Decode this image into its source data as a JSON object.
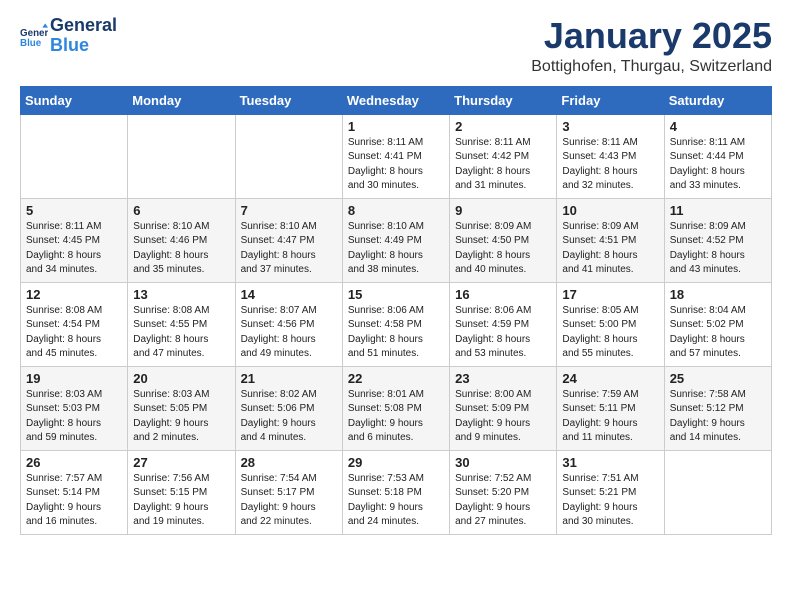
{
  "header": {
    "logo_general": "General",
    "logo_blue": "Blue",
    "month_title": "January 2025",
    "location": "Bottighofen, Thurgau, Switzerland"
  },
  "days_of_week": [
    "Sunday",
    "Monday",
    "Tuesday",
    "Wednesday",
    "Thursday",
    "Friday",
    "Saturday"
  ],
  "weeks": [
    [
      {
        "day": "",
        "info": ""
      },
      {
        "day": "",
        "info": ""
      },
      {
        "day": "",
        "info": ""
      },
      {
        "day": "1",
        "info": "Sunrise: 8:11 AM\nSunset: 4:41 PM\nDaylight: 8 hours\nand 30 minutes."
      },
      {
        "day": "2",
        "info": "Sunrise: 8:11 AM\nSunset: 4:42 PM\nDaylight: 8 hours\nand 31 minutes."
      },
      {
        "day": "3",
        "info": "Sunrise: 8:11 AM\nSunset: 4:43 PM\nDaylight: 8 hours\nand 32 minutes."
      },
      {
        "day": "4",
        "info": "Sunrise: 8:11 AM\nSunset: 4:44 PM\nDaylight: 8 hours\nand 33 minutes."
      }
    ],
    [
      {
        "day": "5",
        "info": "Sunrise: 8:11 AM\nSunset: 4:45 PM\nDaylight: 8 hours\nand 34 minutes."
      },
      {
        "day": "6",
        "info": "Sunrise: 8:10 AM\nSunset: 4:46 PM\nDaylight: 8 hours\nand 35 minutes."
      },
      {
        "day": "7",
        "info": "Sunrise: 8:10 AM\nSunset: 4:47 PM\nDaylight: 8 hours\nand 37 minutes."
      },
      {
        "day": "8",
        "info": "Sunrise: 8:10 AM\nSunset: 4:49 PM\nDaylight: 8 hours\nand 38 minutes."
      },
      {
        "day": "9",
        "info": "Sunrise: 8:09 AM\nSunset: 4:50 PM\nDaylight: 8 hours\nand 40 minutes."
      },
      {
        "day": "10",
        "info": "Sunrise: 8:09 AM\nSunset: 4:51 PM\nDaylight: 8 hours\nand 41 minutes."
      },
      {
        "day": "11",
        "info": "Sunrise: 8:09 AM\nSunset: 4:52 PM\nDaylight: 8 hours\nand 43 minutes."
      }
    ],
    [
      {
        "day": "12",
        "info": "Sunrise: 8:08 AM\nSunset: 4:54 PM\nDaylight: 8 hours\nand 45 minutes."
      },
      {
        "day": "13",
        "info": "Sunrise: 8:08 AM\nSunset: 4:55 PM\nDaylight: 8 hours\nand 47 minutes."
      },
      {
        "day": "14",
        "info": "Sunrise: 8:07 AM\nSunset: 4:56 PM\nDaylight: 8 hours\nand 49 minutes."
      },
      {
        "day": "15",
        "info": "Sunrise: 8:06 AM\nSunset: 4:58 PM\nDaylight: 8 hours\nand 51 minutes."
      },
      {
        "day": "16",
        "info": "Sunrise: 8:06 AM\nSunset: 4:59 PM\nDaylight: 8 hours\nand 53 minutes."
      },
      {
        "day": "17",
        "info": "Sunrise: 8:05 AM\nSunset: 5:00 PM\nDaylight: 8 hours\nand 55 minutes."
      },
      {
        "day": "18",
        "info": "Sunrise: 8:04 AM\nSunset: 5:02 PM\nDaylight: 8 hours\nand 57 minutes."
      }
    ],
    [
      {
        "day": "19",
        "info": "Sunrise: 8:03 AM\nSunset: 5:03 PM\nDaylight: 8 hours\nand 59 minutes."
      },
      {
        "day": "20",
        "info": "Sunrise: 8:03 AM\nSunset: 5:05 PM\nDaylight: 9 hours\nand 2 minutes."
      },
      {
        "day": "21",
        "info": "Sunrise: 8:02 AM\nSunset: 5:06 PM\nDaylight: 9 hours\nand 4 minutes."
      },
      {
        "day": "22",
        "info": "Sunrise: 8:01 AM\nSunset: 5:08 PM\nDaylight: 9 hours\nand 6 minutes."
      },
      {
        "day": "23",
        "info": "Sunrise: 8:00 AM\nSunset: 5:09 PM\nDaylight: 9 hours\nand 9 minutes."
      },
      {
        "day": "24",
        "info": "Sunrise: 7:59 AM\nSunset: 5:11 PM\nDaylight: 9 hours\nand 11 minutes."
      },
      {
        "day": "25",
        "info": "Sunrise: 7:58 AM\nSunset: 5:12 PM\nDaylight: 9 hours\nand 14 minutes."
      }
    ],
    [
      {
        "day": "26",
        "info": "Sunrise: 7:57 AM\nSunset: 5:14 PM\nDaylight: 9 hours\nand 16 minutes."
      },
      {
        "day": "27",
        "info": "Sunrise: 7:56 AM\nSunset: 5:15 PM\nDaylight: 9 hours\nand 19 minutes."
      },
      {
        "day": "28",
        "info": "Sunrise: 7:54 AM\nSunset: 5:17 PM\nDaylight: 9 hours\nand 22 minutes."
      },
      {
        "day": "29",
        "info": "Sunrise: 7:53 AM\nSunset: 5:18 PM\nDaylight: 9 hours\nand 24 minutes."
      },
      {
        "day": "30",
        "info": "Sunrise: 7:52 AM\nSunset: 5:20 PM\nDaylight: 9 hours\nand 27 minutes."
      },
      {
        "day": "31",
        "info": "Sunrise: 7:51 AM\nSunset: 5:21 PM\nDaylight: 9 hours\nand 30 minutes."
      },
      {
        "day": "",
        "info": ""
      }
    ]
  ]
}
